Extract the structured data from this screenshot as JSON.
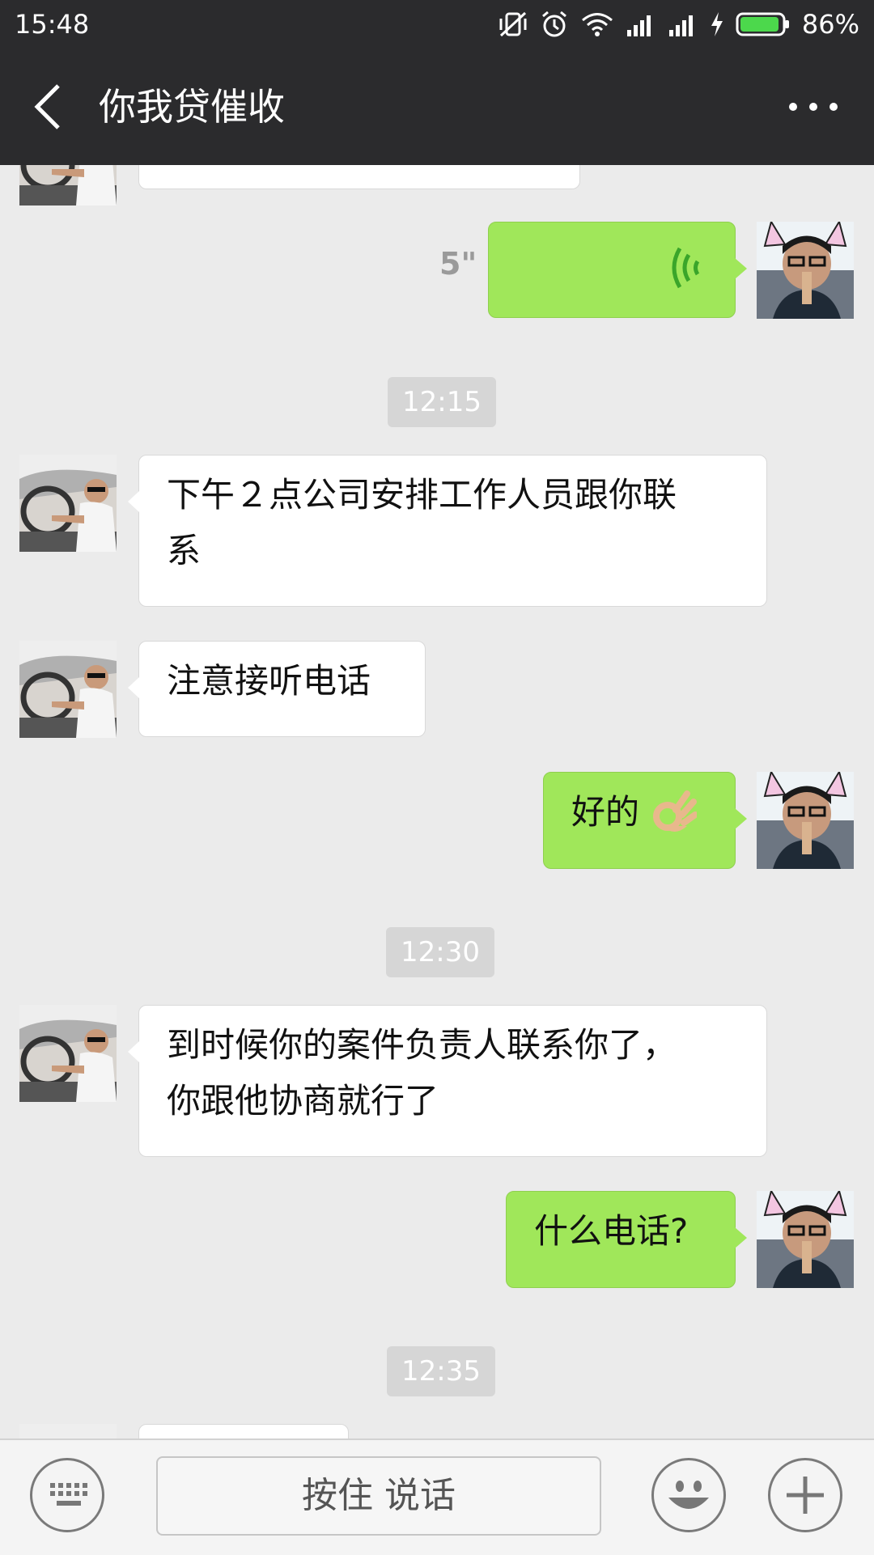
{
  "status_bar": {
    "time": "15:48",
    "battery": "86%"
  },
  "header": {
    "title": "你我贷催收"
  },
  "messages": {
    "voice": {
      "duration": "5\""
    },
    "ts1": "12:15",
    "m1": {
      "line1": "下午２点公司安排工作人员跟你联",
      "line2": "系"
    },
    "m2": "注意接听电话",
    "m3": "好的",
    "ts2": "12:30",
    "m4": {
      "line1": "到时候你的案件负责人联系你了，",
      "line2": "你跟他协商就行了"
    },
    "m5": "什么电话?",
    "ts3": "12:35"
  },
  "input_bar": {
    "hold_to_talk": "按住 说话"
  },
  "icons": [
    "back-arrow-icon",
    "more-icon",
    "keyboard-icon",
    "emoji-icon",
    "plus-icon",
    "voice-wave-icon",
    "ok-hand-icon"
  ],
  "colors": {
    "header_bg": "#2b2b2d",
    "chat_bg": "#ebebeb",
    "outgoing_bubble": "#a0e75a",
    "incoming_bubble": "#ffffff"
  }
}
